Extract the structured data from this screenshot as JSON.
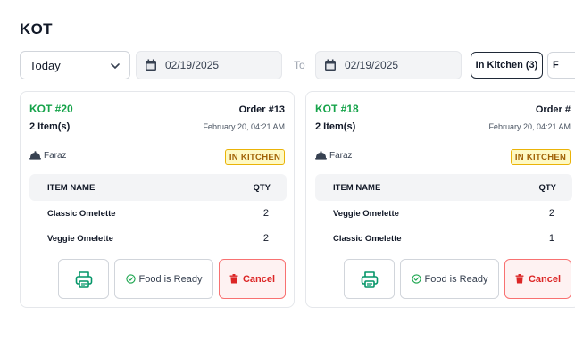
{
  "page": {
    "title": "KOT"
  },
  "filters": {
    "period": "Today",
    "date_from": "02/19/2025",
    "to_label": "To",
    "date_to": "02/19/2025",
    "status_active": "In Kitchen (3)",
    "status_next": "F"
  },
  "kot_cards": [
    {
      "kot_number": "KOT #20",
      "order_number": "Order #13",
      "item_count": "2 Item(s)",
      "date": "February 20, 04:21 AM",
      "waiter": "Faraz",
      "status": "IN KITCHEN",
      "table_headers": {
        "name": "ITEM NAME",
        "qty": "QTY"
      },
      "items": [
        {
          "name": "Classic Omelette",
          "qty": "2"
        },
        {
          "name": "Veggie Omelette",
          "qty": "2"
        }
      ],
      "ready_label": "Food is Ready",
      "cancel_label": "Cancel"
    },
    {
      "kot_number": "KOT #18",
      "order_number": "Order #",
      "item_count": "2 Item(s)",
      "date": "February 20, 04:21 AM",
      "waiter": "Faraz",
      "status": "IN KITCHEN",
      "table_headers": {
        "name": "ITEM NAME",
        "qty": "QTY"
      },
      "items": [
        {
          "name": "Veggie Omelette",
          "qty": "2"
        },
        {
          "name": "Classic Omelette",
          "qty": "1"
        }
      ],
      "ready_label": "Food is Ready",
      "cancel_label": "Cancel"
    }
  ],
  "colors": {
    "kot_green": "#16a34a",
    "badge_yellow": "#fef9c3",
    "cancel_red": "#dc2626",
    "print_green": "#059669"
  },
  "icons": {
    "period": "chevron-down-icon",
    "date": "calendar-icon",
    "waiter": "waiter-icon",
    "print": "printer-icon",
    "ready": "check-circle-icon",
    "cancel": "trash-icon"
  }
}
